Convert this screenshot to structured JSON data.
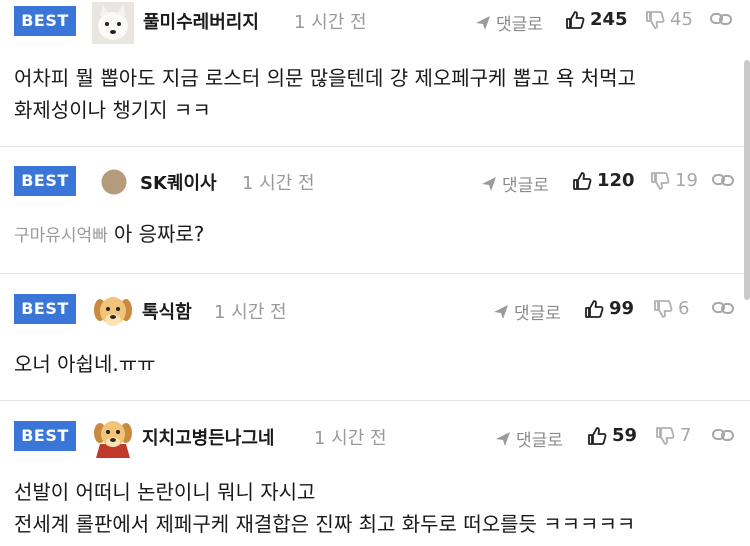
{
  "comments": [
    {
      "badge": "BEST",
      "nickname": "풀미수레버리지",
      "time": "1 시간 전",
      "reply_label": "댓글로",
      "likes": "245",
      "dislikes": "45",
      "lines": [
        "어차피 뭘 뽑아도 지금 로스터 의문 많을텐데 걍 제오페구케 뽑고 욕 처먹고",
        "화제성이나 챙기지 ㅋㅋ"
      ]
    },
    {
      "badge": "BEST",
      "nickname": "SK퀘이사",
      "time": "1 시간 전",
      "reply_label": "댓글로",
      "likes": "120",
      "dislikes": "19",
      "mention": "구마유시억빠",
      "lines": [
        "아 응짜로?"
      ]
    },
    {
      "badge": "BEST",
      "nickname": "톡식함",
      "time": "1 시간 전",
      "reply_label": "댓글로",
      "likes": "99",
      "dislikes": "6",
      "lines": [
        "오너 아쉽네.ㅠㅠ"
      ]
    },
    {
      "badge": "BEST",
      "nickname": "지치고병든나그네",
      "time": "1 시간 전",
      "reply_label": "댓글로",
      "likes": "59",
      "dislikes": "7",
      "lines": [
        "선발이 어떠니 논란이니 뭐니 자시고",
        "전세계 롤판에서 제페구케 재결합은 진짜 최고 화두로 떠오를듯 ㅋㅋㅋㅋㅋ"
      ]
    }
  ]
}
